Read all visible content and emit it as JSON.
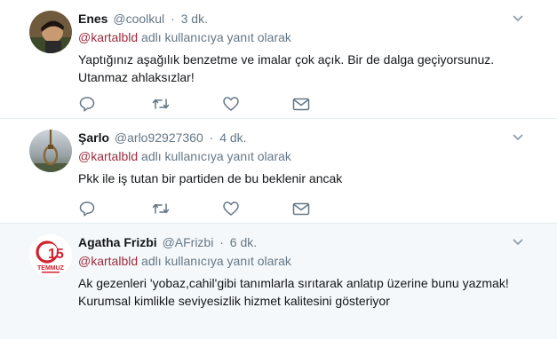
{
  "reply_suffix": "adlı kullanıcıya yanıt olarak",
  "tweets": [
    {
      "name": "Enes",
      "handle": "@coolkul",
      "time": "3 dk.",
      "mention": "@kartalbld",
      "lines": [
        "Yaptığınız aşağılık benzetme ve imalar çok açık. Bir de dalga geçiyorsunuz.",
        "Utanmaz ahlaksızlar!"
      ],
      "avatar": "person-photo"
    },
    {
      "name": "Şarlo",
      "handle": "@arlo92927360",
      "time": "4 dk.",
      "mention": "@kartalbld",
      "lines": [
        "Pkk ile iş tutan bir partiden de bu beklenir ancak"
      ],
      "avatar": "noose-photo"
    },
    {
      "name": "Agatha Frizbi",
      "handle": "@AFrizbi",
      "time": "6 dk.",
      "mention": "@kartalbld",
      "lines": [
        "Ak gezenleri 'yobaz,cahil'gibi tanımlarla sırıtarak anlatıp üzerine bunu yazmak!",
        "Kurumsal kimlikle seviyesizlik hizmet kalitesini gösteriyor"
      ],
      "avatar": "15-temmuz-logo",
      "avatar_text": "TEMMUZ"
    }
  ],
  "colors": {
    "mention": "#9d2c3f",
    "secondary": "#657786",
    "icon": "#657786",
    "highlight_bg": "#f5f8fa"
  }
}
